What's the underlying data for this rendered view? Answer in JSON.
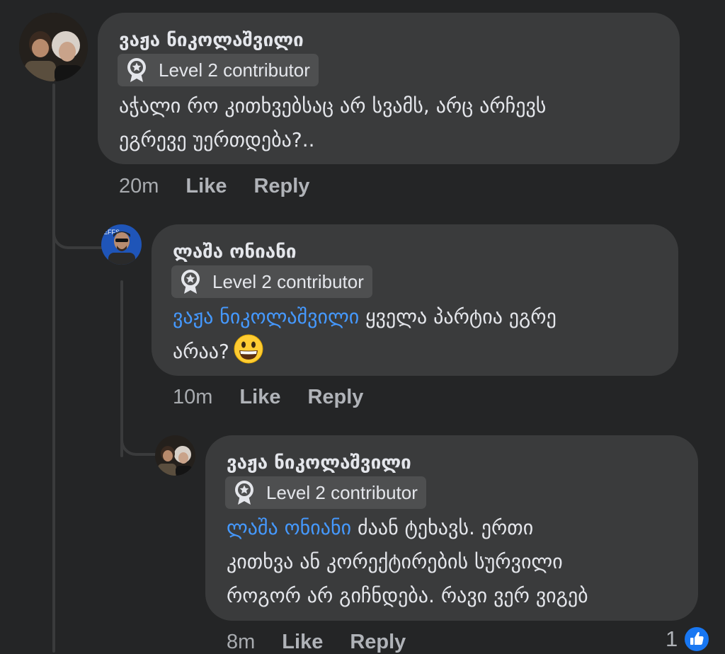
{
  "comments": [
    {
      "author": "ვაჟა ნიკოლაშვილი",
      "badge": "Level 2 contributor",
      "mention": "",
      "text_line1": "აჭალი რო კითხვებსაც არ სვამს, არც არჩევს",
      "text_line2": "ეგრევე უერთდება?..",
      "time": "20m",
      "like": "Like",
      "reply": "Reply"
    },
    {
      "author": "ლაშა ონიანი",
      "badge": "Level 2 contributor",
      "mention": "ვაჟა ნიკოლაშვილი",
      "text_line1_rest": " ყველა პარტია ეგრე",
      "text_line2": "არაა?",
      "emoji": "grinning-face-emoji",
      "time": "10m",
      "like": "Like",
      "reply": "Reply"
    },
    {
      "author": "ვაჟა ნიკოლაშვილი",
      "badge": "Level 2 contributor",
      "mention": "ლაშა ონიანი",
      "text_line1_rest": " ძაან ტეხავს. ერთი",
      "text_line2": "კითხვა ან კორექტირების სურვილი",
      "text_line3": "როგორ არ გიჩნდება. რავი ვერ ვიგებ",
      "time": "8m",
      "like": "Like",
      "reply": "Reply",
      "reaction_count": "1",
      "reaction_icon": "like-thumb-icon"
    }
  ],
  "colors": {
    "background": "#242526",
    "bubble": "#3a3b3c",
    "badge": "#4e4f50",
    "mention": "#4599ff",
    "like_blue": "#1877f2"
  }
}
